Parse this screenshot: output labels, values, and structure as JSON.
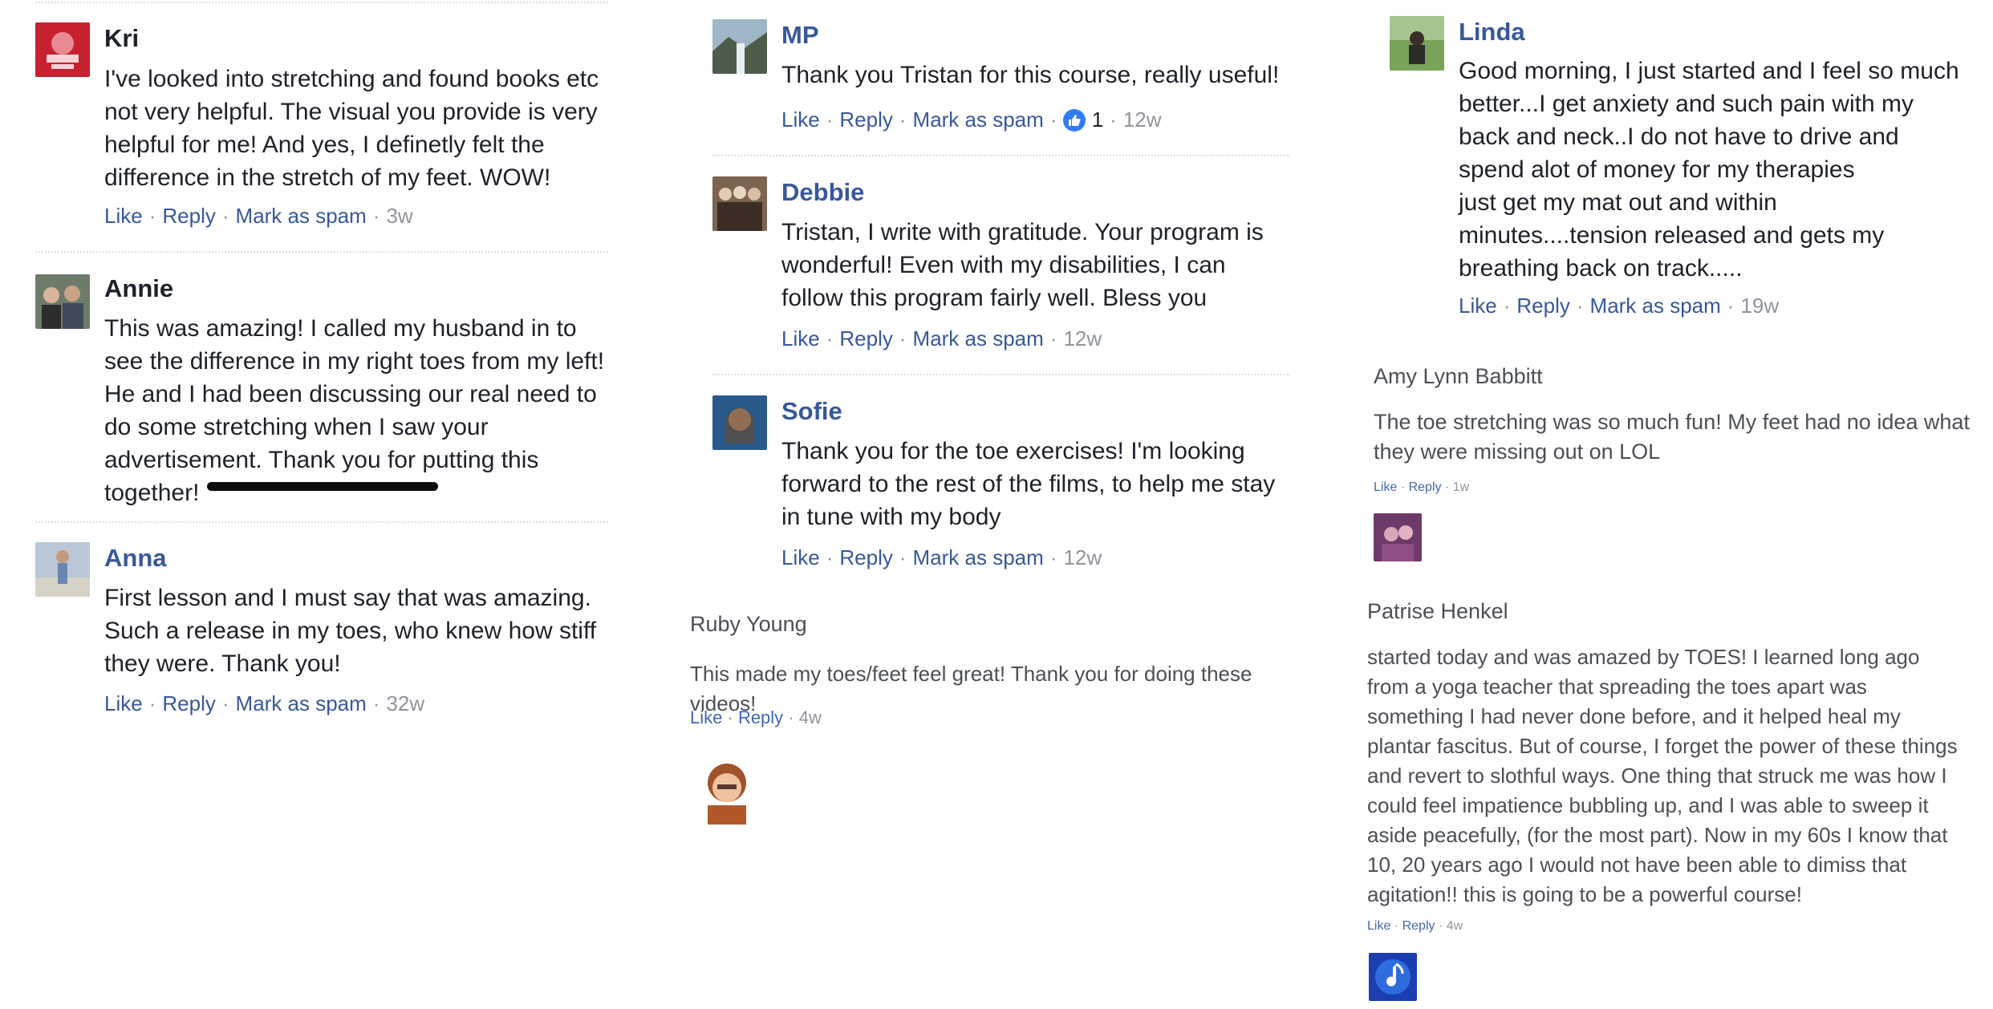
{
  "colors": {
    "link_blue": "#385898",
    "time_gray": "#90949c",
    "text_dark": "#1d2129",
    "reaction_blue": "#2f7cf6"
  },
  "actions": {
    "like": "Like",
    "reply": "Reply",
    "spam": "Mark as spam",
    "dot": "·"
  },
  "comments": {
    "kri": {
      "name": "Kri",
      "text": "I've looked into stretching and found books etc\nnot very helpful. The visual you provide is very\nhelpful for me! And yes, I definetly felt the\ndifference in the stretch of my feet. WOW!",
      "time": "3w",
      "avatar_icon": "profile-photo-icon"
    },
    "annie": {
      "name": "Annie",
      "text": "This was amazing! I called my husband in to\nsee the difference in my right toes from my left!\nHe and I had been discussing our real need to\ndo some stretching when I saw your\nadvertisement. Thank you for putting this\ntogether!",
      "avatar_icon": "profile-photo-icon"
    },
    "anna": {
      "name": "Anna",
      "text": "First lesson and I must say that was amazing.\nSuch a release in my toes, who knew how stiff\nthey were. Thank you!",
      "time": "32w",
      "avatar_icon": "profile-photo-icon"
    },
    "mp": {
      "name": "MP",
      "text": "Thank you Tristan for this course, really useful!",
      "reaction_count": "1",
      "reaction_icon": "thumbs-up-icon",
      "time": "12w",
      "avatar_icon": "landscape-photo-icon"
    },
    "debbie": {
      "name": "Debbie",
      "text": "Tristan, I write with gratitude. Your program is\nwonderful! Even with my disabilities, I can\nfollow this program fairly well. Bless you",
      "time": "12w",
      "avatar_icon": "profile-photo-icon"
    },
    "sofie": {
      "name": "Sofie",
      "text": "Thank you for the toe exercises! I'm looking\nforward to the rest of the films, to help me stay\nin tune with my body",
      "time": "12w",
      "avatar_icon": "profile-photo-icon"
    },
    "ruby": {
      "name": "Ruby Young",
      "text": "This made my toes/feet feel great! Thank you for doing these videos!",
      "time": "4w",
      "avatar_icon": "profile-photo-icon"
    },
    "linda": {
      "name": "Linda",
      "text": "Good morning, I just started and I feel so much\nbetter...I get anxiety and such pain with my\nback and neck..I do not have to drive and\nspend alot of money for my therapies\njust get my mat out and within\nminutes....tension released and gets my\nbreathing back on track.....",
      "time": "19w",
      "avatar_icon": "profile-photo-icon"
    },
    "amy": {
      "name": "Amy Lynn Babbitt",
      "text": "The toe stretching was so much fun! My feet had no idea what\nthey were missing out on LOL",
      "time": "1w",
      "avatar_icon": "profile-photo-icon"
    },
    "patrise": {
      "name": "Patrise Henkel",
      "text": "started today and was amazed by TOES! I learned long ago\nfrom a yoga teacher that spreading the toes apart was\nsomething I had never done before, and it helped heal my\nplantar fascitus. But of course, I forget the power of these things\nand revert to slothful ways. One thing that struck me was how I\ncould feel impatience bubbling up, and I was able to sweep it\naside peacefully, (for the most part). Now in my 60s I know that\n10, 20 years ago I would not have been able to dimiss that\nagitation!! this is going to be a powerful course!",
      "time": "4w",
      "avatar_icon": "music-note-icon"
    }
  }
}
